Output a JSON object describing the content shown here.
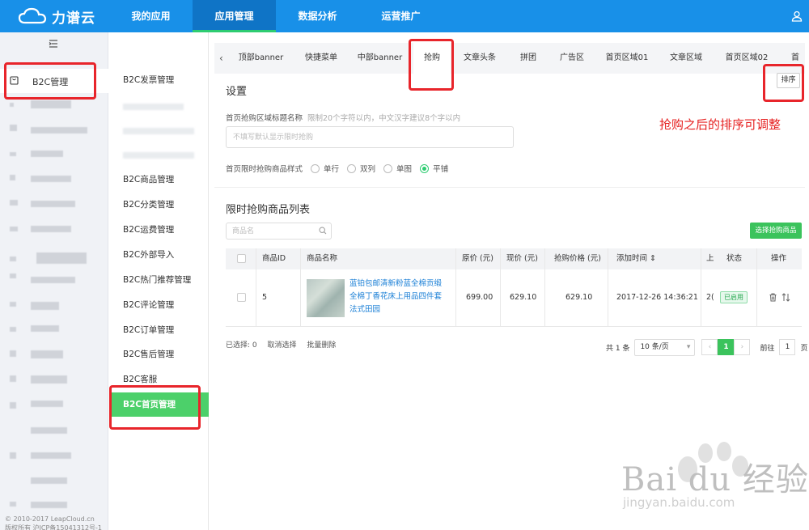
{
  "topbar": {
    "logo": "力谱云",
    "nav": [
      "我的应用",
      "应用管理",
      "数据分析",
      "运营推广"
    ],
    "active_index": 1
  },
  "sidebar": {
    "active_item": "B2C管理",
    "copyright": "© 2010-2017 LeapCloud.cn",
    "copyright2": "版权所有 沪ICP备15041312号-1"
  },
  "subnav": {
    "items": [
      "B2C发票管理",
      "B2C商品管理",
      "B2C分类管理",
      "B2C运费管理",
      "B2C外部导入",
      "B2C热门推荐管理",
      "B2C评论管理",
      "B2C订单管理",
      "B2C售后管理",
      "B2C客服",
      "B2C首页管理"
    ]
  },
  "tabs": {
    "items": [
      "顶部banner",
      "快捷菜单",
      "中部banner",
      "抢购",
      "文章头条",
      "拼团",
      "广告区",
      "首页区域01",
      "文章区域",
      "首页区域02",
      "首"
    ],
    "active": "抢购"
  },
  "settings": {
    "title": "设置",
    "sort_label": "排序",
    "title_field_label": "首页抢购区域标题名称",
    "title_field_hint": "限制20个字符以内，中文汉字建议8个字以内",
    "title_placeholder": "不填写默认显示限时抢购",
    "style_label": "首页限时抢购商品样式",
    "style_options": [
      "单行",
      "双列",
      "单图",
      "平铺"
    ],
    "style_selected": "平铺"
  },
  "annotation": "抢购之后的排序可调整",
  "list": {
    "title": "限时抢购商品列表",
    "search_placeholder": "商品名",
    "select_button": "选择抢购商品",
    "columns": [
      "商品ID",
      "商品名称",
      "原价 (元)",
      "现价 (元)",
      "抢购价格 (元)",
      "添加时间",
      "上",
      "状态",
      "操作"
    ],
    "rows": [
      {
        "id": "5",
        "name": "蓝铂包邮清新粉蓝全棉贡缎全棉丁香花床上用品四件套法式田园",
        "original_price": "699.00",
        "current_price": "629.10",
        "flash_price": "629.10",
        "added_time": "2017-12-26 14:36:21",
        "col_partial": "2(",
        "status": "已启用"
      }
    ]
  },
  "footer": {
    "selected": "已选择: 0",
    "cancel": "取消选择",
    "batch_delete": "批量删除",
    "total": "共 1 条",
    "page_size": "10 条/页",
    "current_page": "1",
    "goto_label": "前往",
    "goto_value": "1",
    "page_unit": "页"
  },
  "watermark": {
    "text": "Bai du 经验",
    "url": "jingyan.baidu.com"
  },
  "colors": {
    "topbar": "#1890e8",
    "accent_green": "#3bc35c",
    "annotation_red": "#e8252b"
  }
}
